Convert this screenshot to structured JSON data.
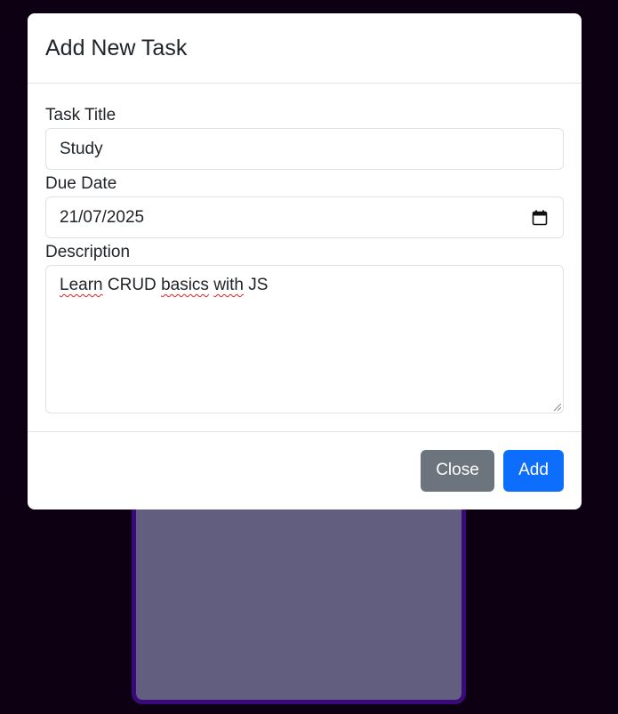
{
  "modal": {
    "title": "Add New Task",
    "fields": {
      "title_label": "Task Title",
      "title_value": "Study",
      "date_label": "Due Date",
      "date_value": "21/07/2025",
      "description_label": "Description",
      "description_words": [
        "Learn",
        "CRUD",
        "basics",
        "with",
        "JS"
      ]
    },
    "buttons": {
      "close_label": "Close",
      "add_label": "Add"
    }
  },
  "icons": {
    "date_picker": "calendar-icon",
    "textarea_resize": "resize-grip-icon"
  },
  "colors": {
    "primary": "#0d6efd",
    "secondary": "#6c757d",
    "backdrop": "#0d0012",
    "background_card": "#615e80",
    "background_card_border": "#3a0a7a"
  }
}
